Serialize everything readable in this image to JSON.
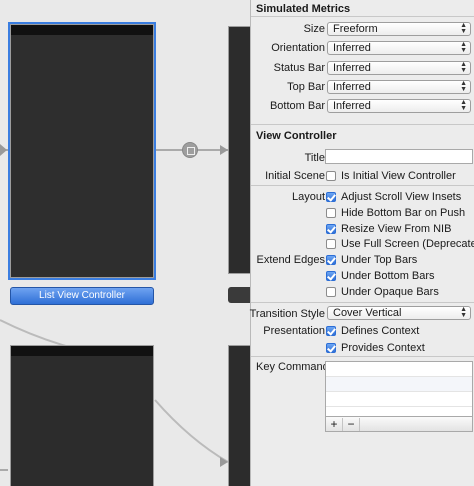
{
  "canvas": {
    "scene_label": "List View Controller"
  },
  "inspector": {
    "simulated_metrics": {
      "title": "Simulated Metrics",
      "rows": [
        {
          "label": "Size",
          "value": "Freeform"
        },
        {
          "label": "Orientation",
          "value": "Inferred"
        },
        {
          "label": "Status Bar",
          "value": "Inferred"
        },
        {
          "label": "Top Bar",
          "value": "Inferred"
        },
        {
          "label": "Bottom Bar",
          "value": "Inferred"
        }
      ]
    },
    "view_controller": {
      "title": "View Controller",
      "title_label": "Title",
      "title_value": "",
      "initial_scene_label": "Initial Scene",
      "initial_scene_check": "Is Initial View Controller",
      "initial_scene_checked": false,
      "layout_label": "Layout",
      "layout_checks": [
        {
          "label": "Adjust Scroll View Insets",
          "checked": true
        },
        {
          "label": "Hide Bottom Bar on Push",
          "checked": false
        },
        {
          "label": "Resize View From NIB",
          "checked": true
        },
        {
          "label": "Use Full Screen (Deprecated)",
          "checked": false
        }
      ],
      "extend_edges_label": "Extend Edges",
      "extend_checks": [
        {
          "label": "Under Top Bars",
          "checked": true
        },
        {
          "label": "Under Bottom Bars",
          "checked": true
        },
        {
          "label": "Under Opaque Bars",
          "checked": false
        }
      ],
      "transition_style_label": "Transition Style",
      "transition_style_value": "Cover Vertical",
      "presentation_label": "Presentation",
      "presentation_checks": [
        {
          "label": "Defines Context",
          "checked": true
        },
        {
          "label": "Provides Context",
          "checked": true
        }
      ],
      "key_commands_label": "Key Commands",
      "add_glyph": "+",
      "remove_glyph": "−"
    }
  },
  "colors": {
    "selection": "#3a7de0",
    "scene_fill": "#2c2c2c",
    "checkbox_on": "#2f6fd6"
  }
}
